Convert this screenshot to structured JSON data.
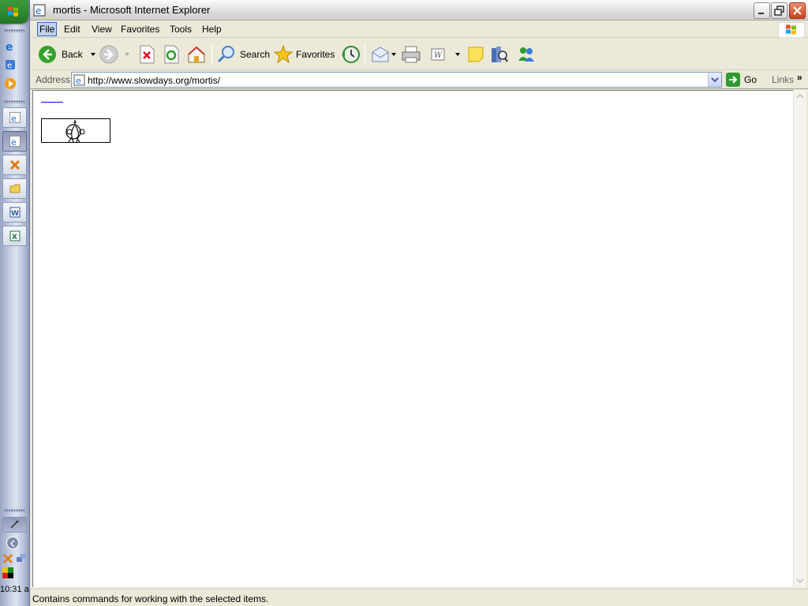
{
  "window": {
    "title": "mortis - Microsoft Internet Explorer"
  },
  "menu": {
    "items": [
      "File",
      "Edit",
      "View",
      "Favorites",
      "Tools",
      "Help"
    ],
    "active": "File"
  },
  "toolbar": {
    "back_label": "Back",
    "search_label": "Search",
    "favorites_label": "Favorites"
  },
  "address": {
    "label": "Address",
    "url": "http://www.slowdays.org/mortis/",
    "go_label": "Go",
    "links_label": "Links"
  },
  "status": {
    "text": "Contains commands for working with the selected items."
  },
  "taskbar": {
    "clock": "10:31 a"
  },
  "colors": {
    "accent": "#316ac5",
    "start_green": "#2f8a2f",
    "close_red": "#c8421e"
  },
  "icons": [
    "windows-logo-icon",
    "ie-icon",
    "media-icon",
    "folder-icon",
    "word-icon",
    "excel-icon",
    "back-icon",
    "forward-icon",
    "stop-icon",
    "refresh-icon",
    "home-icon",
    "search-icon",
    "favorites-star-icon",
    "history-icon",
    "mail-icon",
    "print-icon",
    "edit-icon",
    "notes-icon",
    "research-icon",
    "messenger-icon"
  ]
}
